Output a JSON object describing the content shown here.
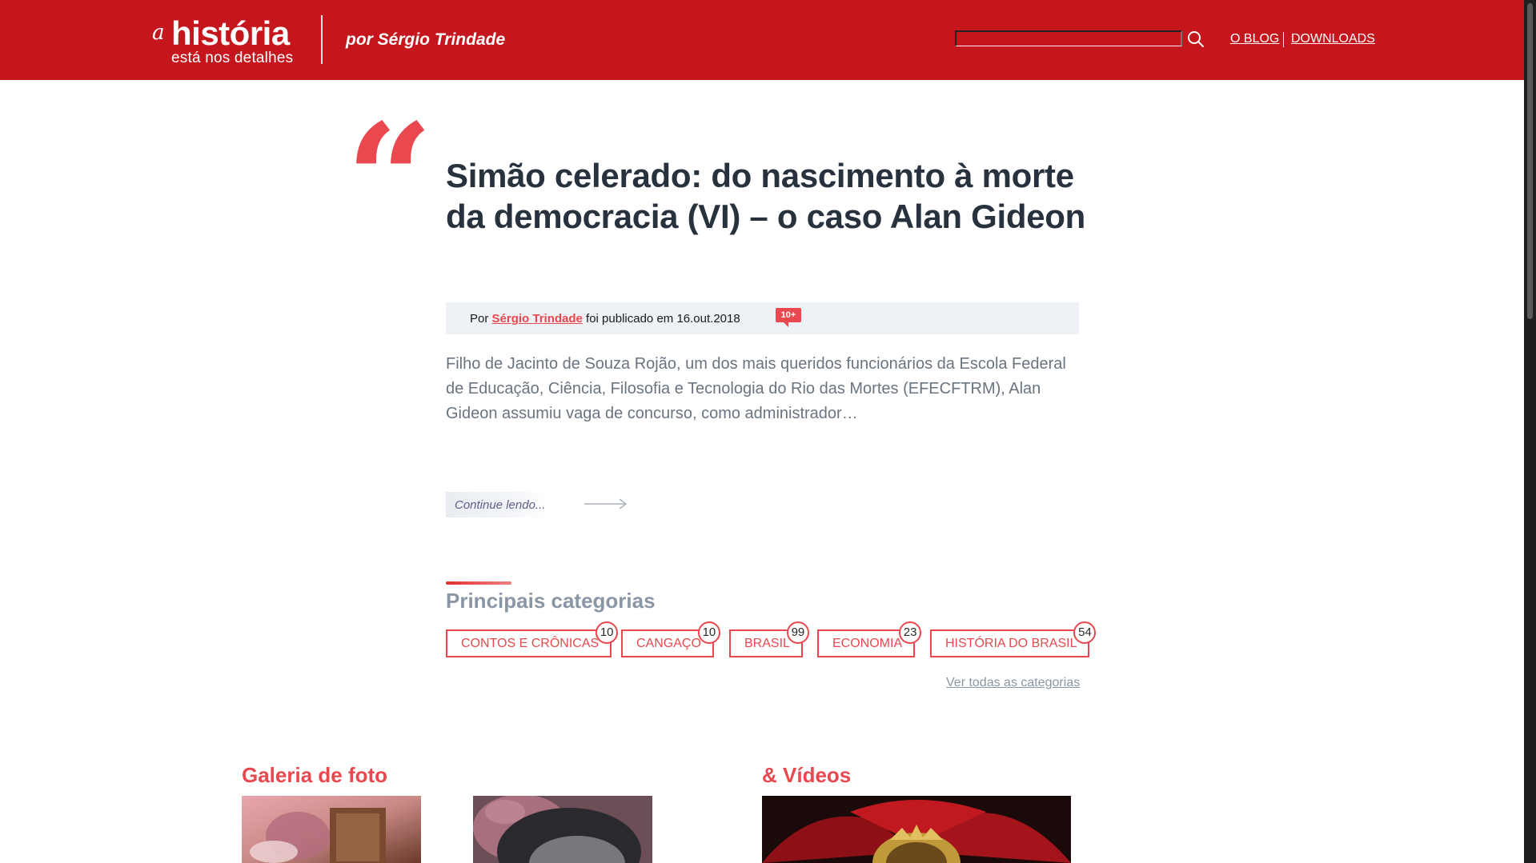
{
  "header": {
    "logo_mark": "a",
    "logo_main": "história",
    "logo_sub": "está nos detalhes",
    "byline": "por Sérgio Trindade",
    "search_placeholder": "",
    "nav": [
      {
        "label": "O BLOG"
      },
      {
        "label": "DOWNLOADS"
      }
    ]
  },
  "post": {
    "quote_glyph": "“",
    "title": "Simão celerado: do nascimento à morte da democracia (VI) – o caso Alan Gideon",
    "meta_prefix": "Por",
    "author": "Sérgio Trindade",
    "meta_suffix": "foi publicado em 16.out.2018",
    "comment_count": "10+",
    "excerpt": "Filho de Jacinto de Souza Rojão, um dos mais queridos funcionários da Escola Federal de Educação, Ciência, Filosofia e Tecnologia do Rio das Mortes (EFECFTRM), Alan Gideon assumiu vaga de concurso, como administrador…",
    "continue_label": "Continue lendo..."
  },
  "categories": {
    "title": "Principais categorias",
    "items": [
      {
        "label": "CONTOS E CRÔNICAS",
        "count": "10"
      },
      {
        "label": "CANGAÇO",
        "count": "10"
      },
      {
        "label": "BRASIL",
        "count": "99"
      },
      {
        "label": "ECONOMIA",
        "count": "23"
      },
      {
        "label": "HISTÓRIA DO BRASIL",
        "count": "54"
      }
    ],
    "see_all": "Ver todas as categorias"
  },
  "gallery": {
    "photos_title": "Galeria de foto",
    "videos_title": "& Vídeos"
  },
  "colors": {
    "brand_red": "#c4161c",
    "accent_red": "#e8484e",
    "title_dark": "#27323e",
    "muted_gray": "#8a96a3"
  }
}
